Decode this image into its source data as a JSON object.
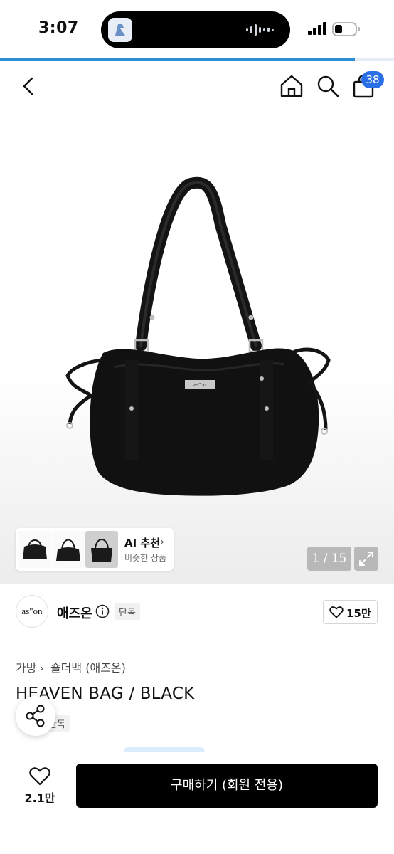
{
  "status_bar": {
    "time": "3:07"
  },
  "page_progress": 0.9,
  "nav": {
    "cart_count": "38"
  },
  "gallery": {
    "current": "1",
    "total": "15",
    "separator": "/",
    "ai_recommend": {
      "title": "AI 추천",
      "subtitle": "비슷한 상품"
    }
  },
  "brand": {
    "logo_text": "as\"on",
    "name": "애즈온",
    "tag": "단독",
    "like_count": "15만"
  },
  "product": {
    "breadcrumb": [
      "가방",
      "숄더백 (애즈온)"
    ],
    "title": "HEAVEN BAG / BLACK",
    "exclusive_tag": "단독",
    "product_label": "as\"on"
  },
  "bottom_bar": {
    "wish_count": "2.1만",
    "buy_label": "구매하기 (회원 전용)"
  },
  "colors": {
    "accent": "#2a6fe6",
    "progress": "#2f8ed8",
    "buy_button": "#000000"
  }
}
